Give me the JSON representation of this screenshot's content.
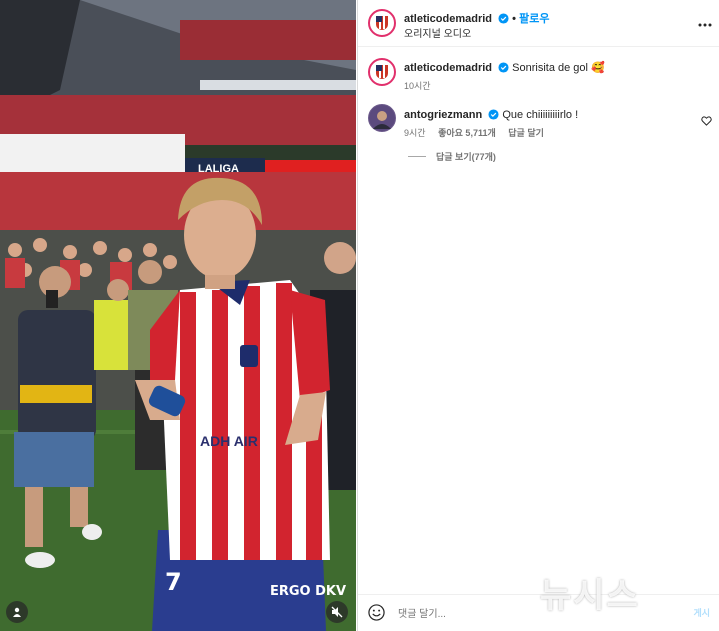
{
  "post": {
    "author": "atleticodemadrid",
    "follow_label": "팔로우",
    "audio": "오리지널 오디오",
    "caption": "Sonrisita de gol 🥰",
    "caption_time": "10시간"
  },
  "comment": {
    "author": "antogriezmann",
    "text": "Que chiiiiiiiiirlo !",
    "time": "9시간",
    "likes": "좋아요 5,711개",
    "reply_label": "답글 달기",
    "view_replies": "답글 보기(77개)"
  },
  "footer": {
    "placeholder": "댓글 달기...",
    "post_label": "게시"
  },
  "media": {
    "banner_text": "LALIGA",
    "player_number": "7",
    "sponsor": "ERGO DKV",
    "chest_text": "ADH AIR"
  },
  "watermark": "뉴시스",
  "colors": {
    "accent": "#0095f6",
    "verified": "#0095f6",
    "atm_red": "#cb3524",
    "atm_blue": "#272e61"
  },
  "icons": [
    "verified-icon",
    "more-icon",
    "heart-icon",
    "emoji-icon",
    "user-tag-icon",
    "mute-icon"
  ]
}
